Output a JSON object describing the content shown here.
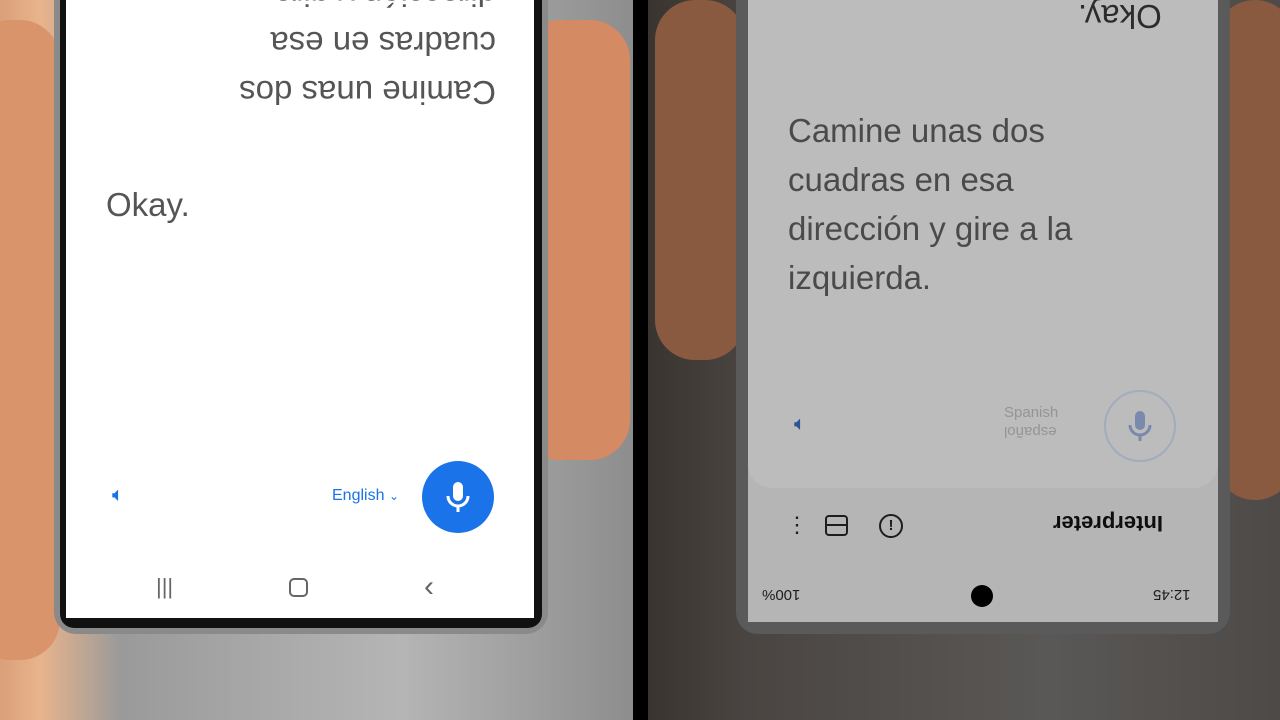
{
  "left_phone": {
    "incoming_text": "Camine unas dos cuadras en esa dirección y gire",
    "own_text": "Okay.",
    "language": "English",
    "speaker_icon": "speaker-icon",
    "mic_icon": "mic-icon",
    "accent": "#1a73e8",
    "nav": {
      "recents": "|||",
      "home": "○",
      "back": "‹"
    }
  },
  "right_phone": {
    "incoming_text": "Okay.",
    "own_text": "Camine unas dos cuadras en esa dirección y gire a la izquierda.",
    "language_primary": "Spanish",
    "language_secondary": "español",
    "app_title": "Interpreter",
    "status": {
      "time": "12:45",
      "battery": "100%"
    }
  }
}
